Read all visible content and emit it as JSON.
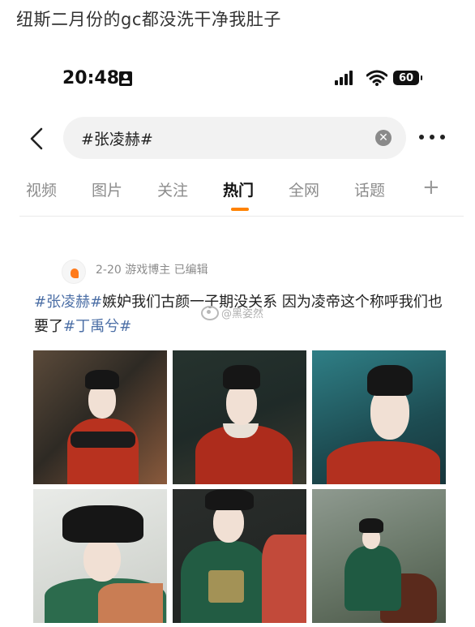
{
  "caption": "纽斯二月份的gc都没洗干净我肚子",
  "status_bar": {
    "time": "20:48",
    "battery": "60"
  },
  "search": {
    "query": "#张凌赫#"
  },
  "tabs": [
    {
      "label": "视频",
      "active": false
    },
    {
      "label": "图片",
      "active": false
    },
    {
      "label": "关注",
      "active": false
    },
    {
      "label": "热门",
      "active": true
    },
    {
      "label": "全网",
      "active": false
    },
    {
      "label": "话题",
      "active": false
    }
  ],
  "tab_add": "+",
  "post": {
    "meta": "2-20  游戏博主  已编辑",
    "hashtag1": "#张凌赫#",
    "text1": "嫉妒我们古颜一子期没关系 因为凌帝这个称呼我们也要了",
    "hashtag2": "#丁禹兮#",
    "watermark": "@黑姿然"
  },
  "photos": [
    {
      "name": "photo-1",
      "theme": "red-robe-studio"
    },
    {
      "name": "photo-2",
      "theme": "red-robe-dark"
    },
    {
      "name": "photo-3",
      "theme": "red-robe-teal"
    },
    {
      "name": "photo-4",
      "theme": "green-robe-snow"
    },
    {
      "name": "photo-5",
      "theme": "green-robe-scarf"
    },
    {
      "name": "photo-6",
      "theme": "green-robe-horse"
    }
  ],
  "colors": {
    "hashtag": "#4c6fa6",
    "tab_indicator": "#ff8200"
  }
}
